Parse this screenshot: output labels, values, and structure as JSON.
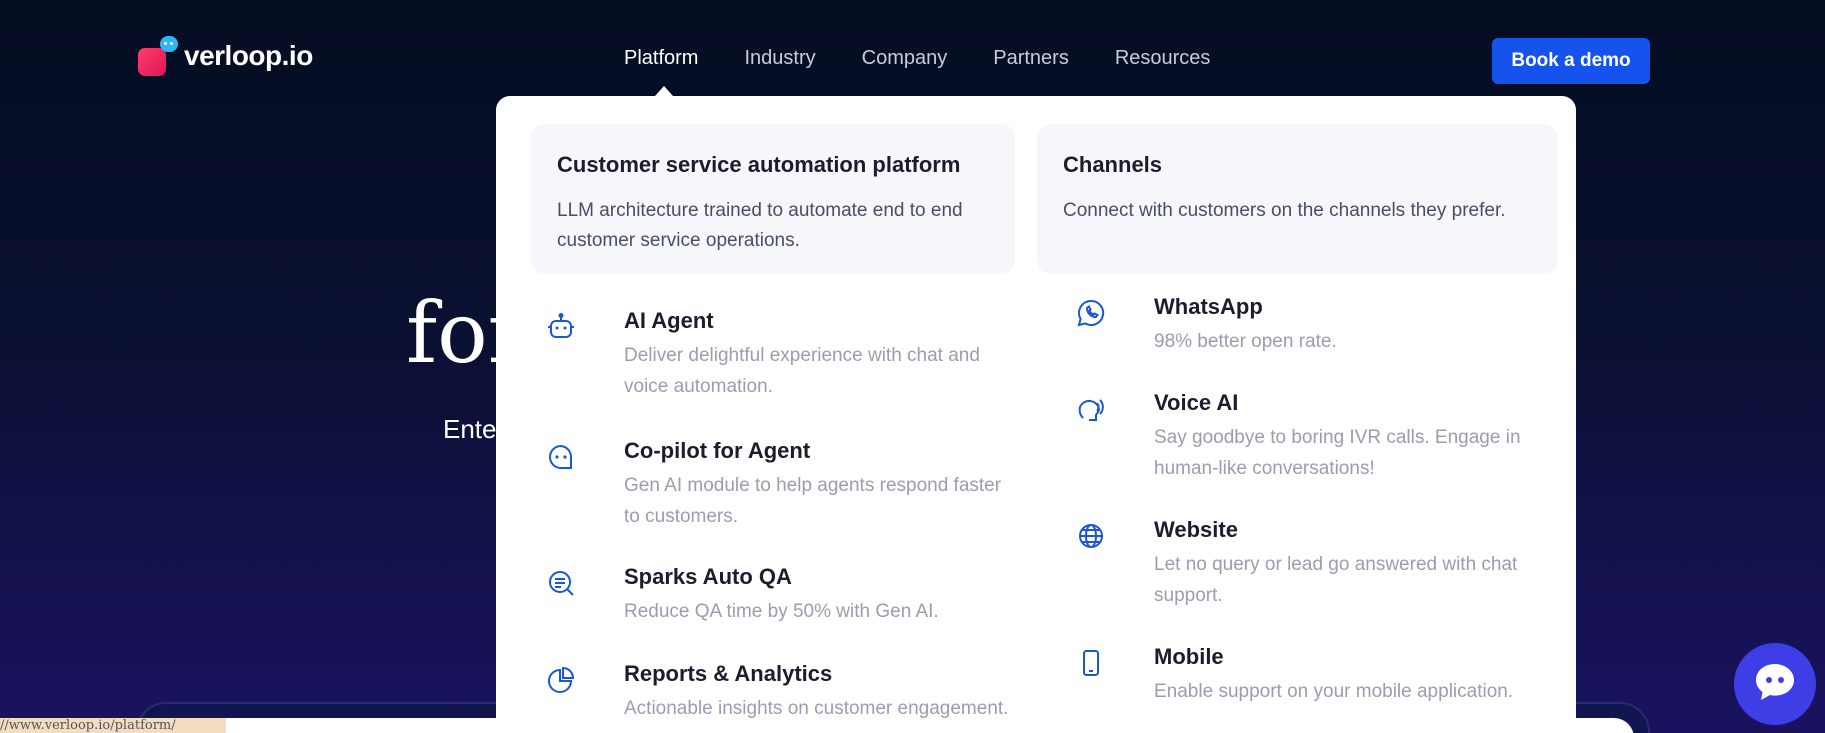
{
  "header": {
    "logo_text": "verloop.io",
    "nav": [
      "Platform",
      "Industry",
      "Company",
      "Partners",
      "Resources"
    ],
    "cta": "Book a demo"
  },
  "hero": {
    "title_fragment": "for",
    "subtitle_fragment": "Ente"
  },
  "dropdown": {
    "left_card": {
      "title": "Customer service automation platform",
      "desc": "LLM architecture trained to automate end to end customer service operations."
    },
    "right_card": {
      "title": "Channels",
      "desc": "Connect with customers on the channels they prefer."
    },
    "left_items": [
      {
        "icon": "robot-icon",
        "title": "AI Agent",
        "desc": "Deliver delightful experience with chat and voice automation."
      },
      {
        "icon": "chat-dots-icon",
        "title": "Co-pilot for Agent",
        "desc": "Gen AI module to help agents respond faster to customers."
      },
      {
        "icon": "search-list-icon",
        "title": "Sparks Auto QA",
        "desc": "Reduce QA time by 50% with Gen AI."
      },
      {
        "icon": "pie-chart-icon",
        "title": "Reports & Analytics",
        "desc": "Actionable insights on customer engagement."
      }
    ],
    "right_items": [
      {
        "icon": "whatsapp-icon",
        "title": "WhatsApp",
        "desc": "98% better open rate."
      },
      {
        "icon": "voice-icon",
        "title": "Voice AI",
        "desc": "Say goodbye to boring IVR calls. Engage in human-like conversations!"
      },
      {
        "icon": "globe-icon",
        "title": "Website",
        "desc": "Let no query or lead go answered with chat support."
      },
      {
        "icon": "mobile-icon",
        "title": "Mobile",
        "desc": "Enable support on your mobile application."
      }
    ]
  },
  "status_url": "//www.verloop.io/platform/",
  "colors": {
    "accent": "#1553ec",
    "icon": "#1a56d6",
    "fab": "#3d3ee6"
  }
}
